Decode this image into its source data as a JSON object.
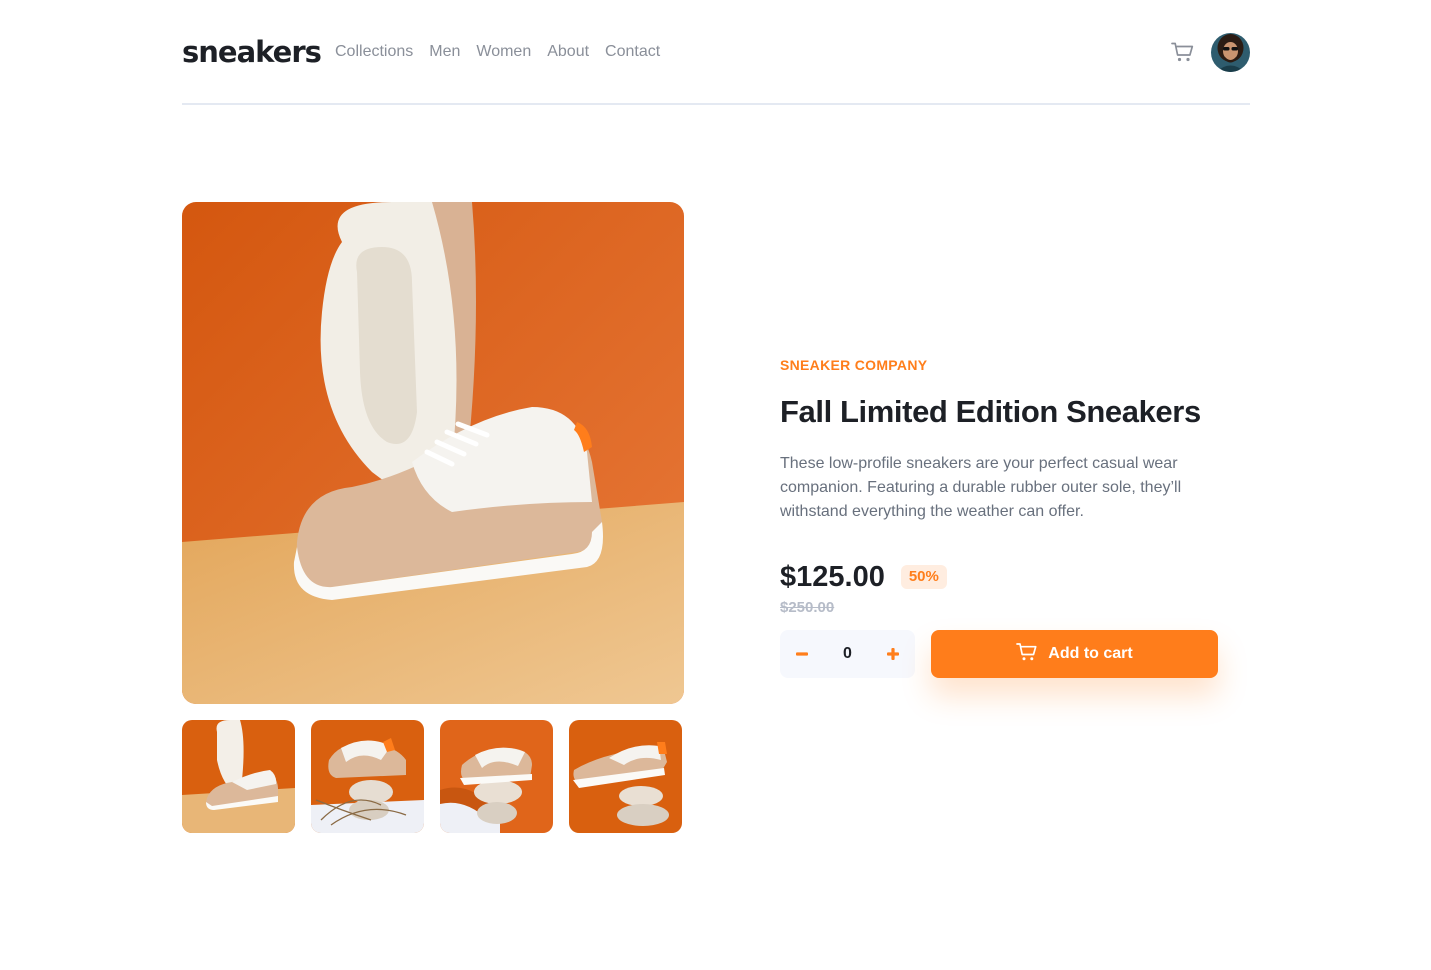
{
  "header": {
    "logo": "sneakers",
    "nav": [
      "Collections",
      "Men",
      "Women",
      "About",
      "Contact"
    ]
  },
  "icons": {
    "cart": "cart-icon",
    "avatar": "user-avatar",
    "minus": "minus-icon",
    "plus": "plus-icon"
  },
  "product": {
    "company": "SNEAKER COMPANY",
    "title": "Fall Limited Edition Sneakers",
    "description": "These low-profile sneakers are your perfect casual wear companion. Featuring a durable rubber outer sole, they’ll withstand everything the weather can offer.",
    "price": "$125.00",
    "discount": "50%",
    "original_price": "$250.00",
    "quantity": "0",
    "add_to_cart": "Add to cart"
  },
  "colors": {
    "accent": "#ff7e1b",
    "accent_light": "#ffede0",
    "dark": "#1d2026",
    "grey": "#68707d"
  }
}
